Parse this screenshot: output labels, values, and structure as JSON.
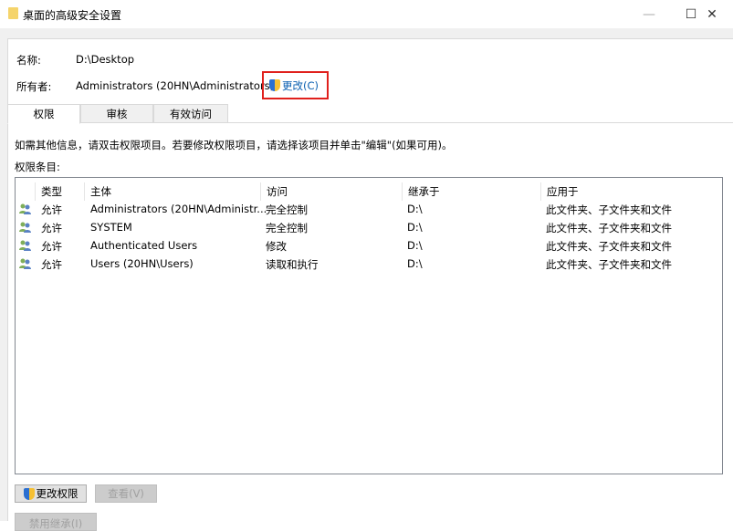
{
  "window": {
    "title": "桌面的高级安全设置",
    "minimize": "—",
    "maximize": "☐",
    "close": "✕"
  },
  "info": {
    "name_label": "名称:",
    "name_value": "D:\\Desktop",
    "owner_label": "所有者:",
    "owner_value": "Administrators (20HN\\Administrators)",
    "change_owner": "更改(C)"
  },
  "tabs": [
    "权限",
    "审核",
    "有效访问"
  ],
  "instructions": "如需其他信息，请双击权限项目。若要修改权限项目，请选择该项目并单击\"编辑\"(如果可用)。",
  "entries_label": "权限条目:",
  "columns": [
    "类型",
    "主体",
    "访问",
    "继承于",
    "应用于"
  ],
  "rows": [
    {
      "type": "允许",
      "principal": "Administrators (20HN\\Administr...",
      "access": "完全控制",
      "inherited": "D:\\",
      "applies": "此文件夹、子文件夹和文件"
    },
    {
      "type": "允许",
      "principal": "SYSTEM",
      "access": "完全控制",
      "inherited": "D:\\",
      "applies": "此文件夹、子文件夹和文件"
    },
    {
      "type": "允许",
      "principal": "Authenticated Users",
      "access": "修改",
      "inherited": "D:\\",
      "applies": "此文件夹、子文件夹和文件"
    },
    {
      "type": "允许",
      "principal": "Users (20HN\\Users)",
      "access": "读取和执行",
      "inherited": "D:\\",
      "applies": "此文件夹、子文件夹和文件"
    }
  ],
  "buttons": {
    "change_permissions": "更改权限",
    "view": "查看(V)",
    "disable_inheritance": "禁用继承(I)"
  }
}
